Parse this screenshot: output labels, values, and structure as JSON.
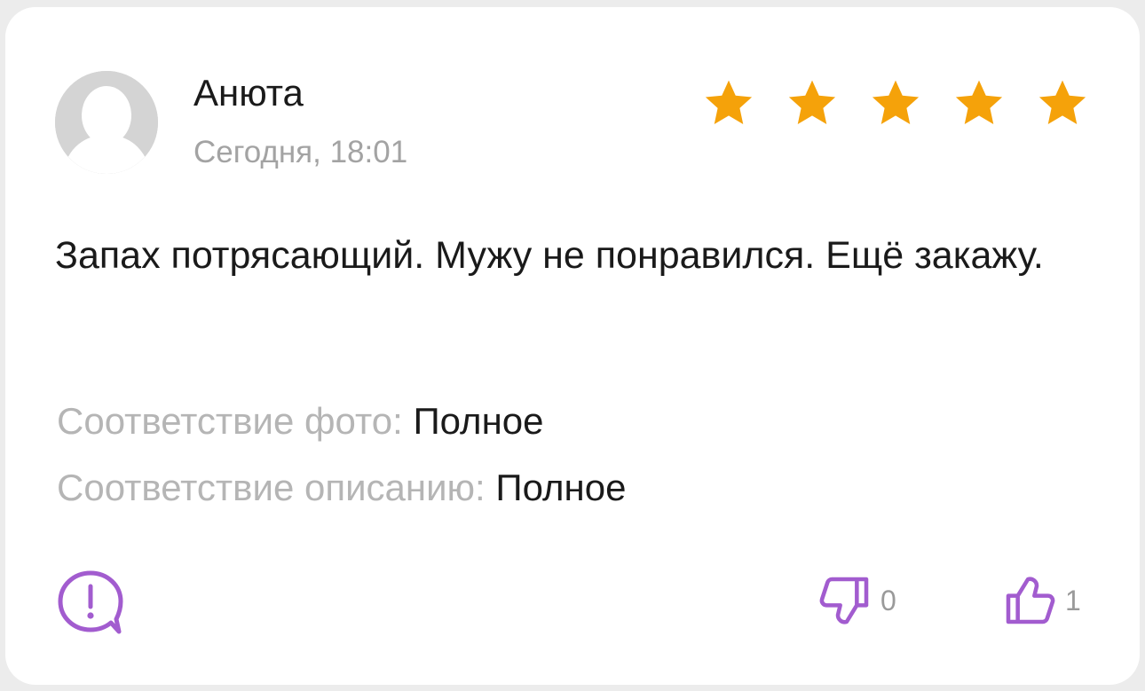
{
  "review": {
    "author": "Анюта",
    "date": "Сегодня, 18:01",
    "rating": 5,
    "rating_max": 5,
    "text": "Запах потрясающий. Мужу не понравился. Ещё закажу.",
    "attributes": [
      {
        "label": "Соответствие фото:",
        "value": "Полное"
      },
      {
        "label": "Соответствие описанию:",
        "value": "Полное"
      }
    ],
    "dislikes": "0",
    "likes": "1"
  },
  "colors": {
    "star": "#f5a20a",
    "accent": "#a25ccf",
    "muted_text": "#a3a3a3",
    "text": "#1a1a1a"
  },
  "icons": {
    "avatar": "user-placeholder-icon",
    "report": "exclamation-bubble-icon",
    "dislike": "thumbs-down-icon",
    "like": "thumbs-up-icon",
    "star": "star-icon"
  }
}
